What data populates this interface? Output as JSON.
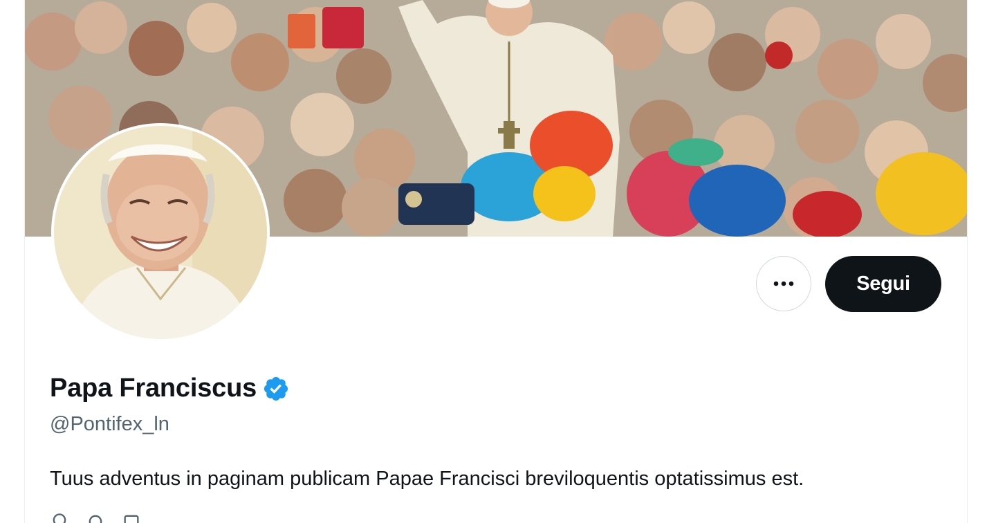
{
  "profile": {
    "display_name": "Papa Franciscus",
    "verified": true,
    "handle": "@Pontifex_ln",
    "bio": "Tuus adventus in paginam publicam Papae Francisci breviloquentis optatissimus est."
  },
  "actions": {
    "more_label": "•••",
    "follow_label": "Segui"
  },
  "icons": {
    "verified": "verified-badge-icon",
    "more": "more-options-icon",
    "location": "location-icon",
    "link": "link-icon",
    "calendar": "calendar-icon"
  },
  "colors": {
    "verified_blue": "#1d9bf0",
    "follow_bg": "#0f1419",
    "follow_text": "#ffffff",
    "secondary_text": "#536471",
    "primary_text": "#0f1419"
  }
}
